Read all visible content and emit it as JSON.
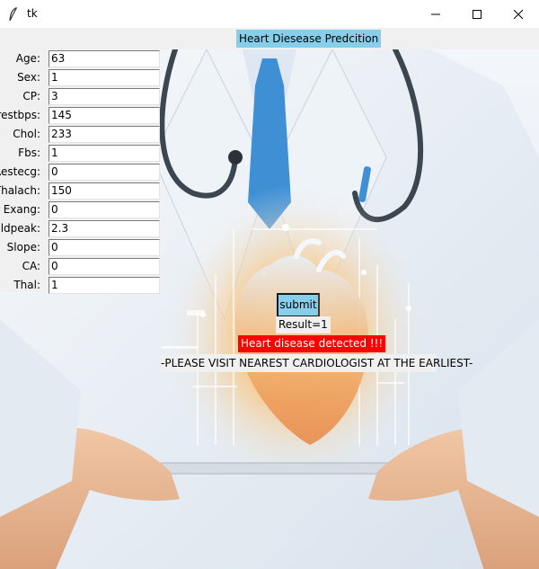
{
  "window": {
    "title": "tk",
    "controls": {
      "minimize": "minimize",
      "maximize": "maximize",
      "close": "close"
    }
  },
  "header": {
    "title": "Heart Diesease Predcition"
  },
  "form": {
    "fields": [
      {
        "label": "Age:",
        "value": "63"
      },
      {
        "label": "Sex:",
        "value": "1"
      },
      {
        "label": "CP:",
        "value": "3"
      },
      {
        "label": "Trestbps:",
        "value": "145"
      },
      {
        "label": "Chol:",
        "value": "233"
      },
      {
        "label": "Fbs:",
        "value": "1"
      },
      {
        "label": "Restecg:",
        "value": "0"
      },
      {
        "label": "Thalach:",
        "value": "150"
      },
      {
        "label": "Exang:",
        "value": "0"
      },
      {
        "label": "Oldpeak:",
        "value": "2.3"
      },
      {
        "label": "Slope:",
        "value": "0"
      },
      {
        "label": "CA:",
        "value": "0"
      },
      {
        "label": "Thal:",
        "value": "1"
      }
    ]
  },
  "actions": {
    "submit_label": "submit"
  },
  "result": {
    "text": "Result=1",
    "alert": "Heart disease detected !!!",
    "advice": "-PLEASE VISIT NEAREST CARDIOLOGIST AT THE EARLIEST-"
  },
  "colors": {
    "header_bg": "#87ceeb",
    "submit_bg": "#87ceeb",
    "alert_bg": "#ff0000",
    "alert_text": "#ffffff"
  }
}
